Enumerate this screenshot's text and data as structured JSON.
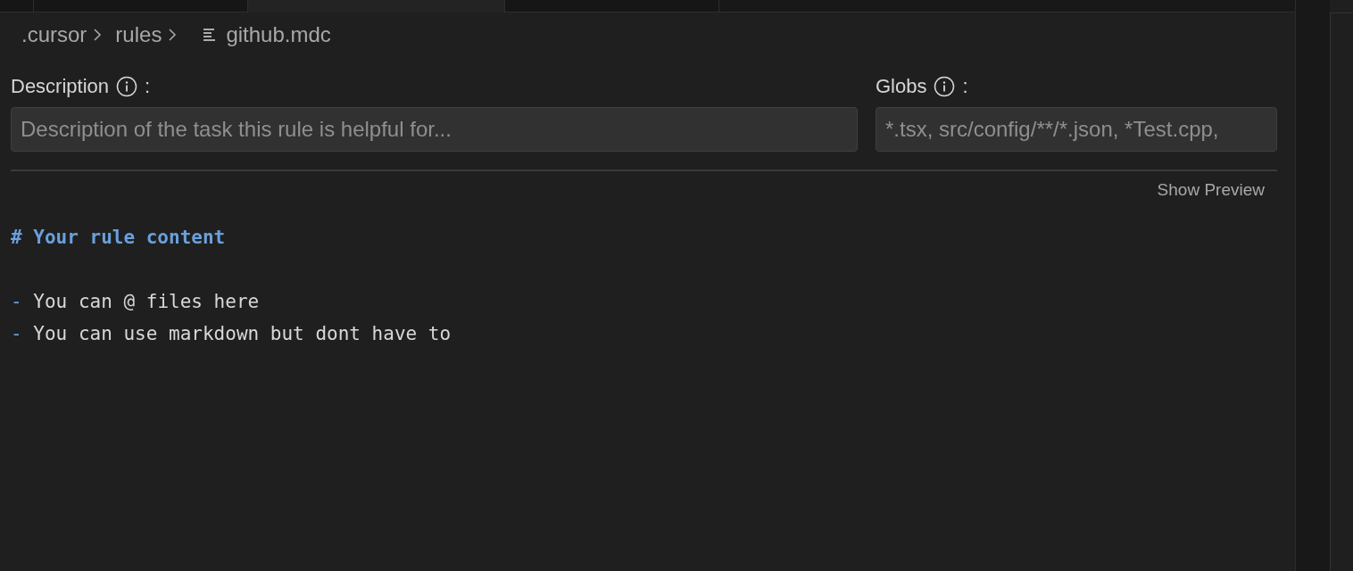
{
  "tabs": [
    {
      "selected": false
    },
    {
      "selected": false
    },
    {
      "selected": true
    },
    {
      "selected": false
    }
  ],
  "breadcrumb": [
    {
      "label": ".cursor",
      "kind": "folder"
    },
    {
      "label": "rules",
      "kind": "folder"
    },
    {
      "label": "github.mdc",
      "kind": "file"
    }
  ],
  "fields": [
    {
      "label": "Description",
      "separator": ":",
      "placeholder": "Description of the task this rule is helpful for..."
    },
    {
      "label": "Globs",
      "separator": ":",
      "placeholder": "*.tsx, src/config/**/*.json, *Test.cpp,"
    }
  ],
  "show_preview": "Show Preview",
  "editor_lines": [
    {
      "kind": "heading",
      "text": "# Your rule content"
    },
    {
      "kind": "blank"
    },
    {
      "kind": "list",
      "marker": "-",
      "text": "You can @ files here"
    },
    {
      "kind": "list",
      "marker": "-",
      "text": "You can use markdown but dont have to"
    }
  ]
}
